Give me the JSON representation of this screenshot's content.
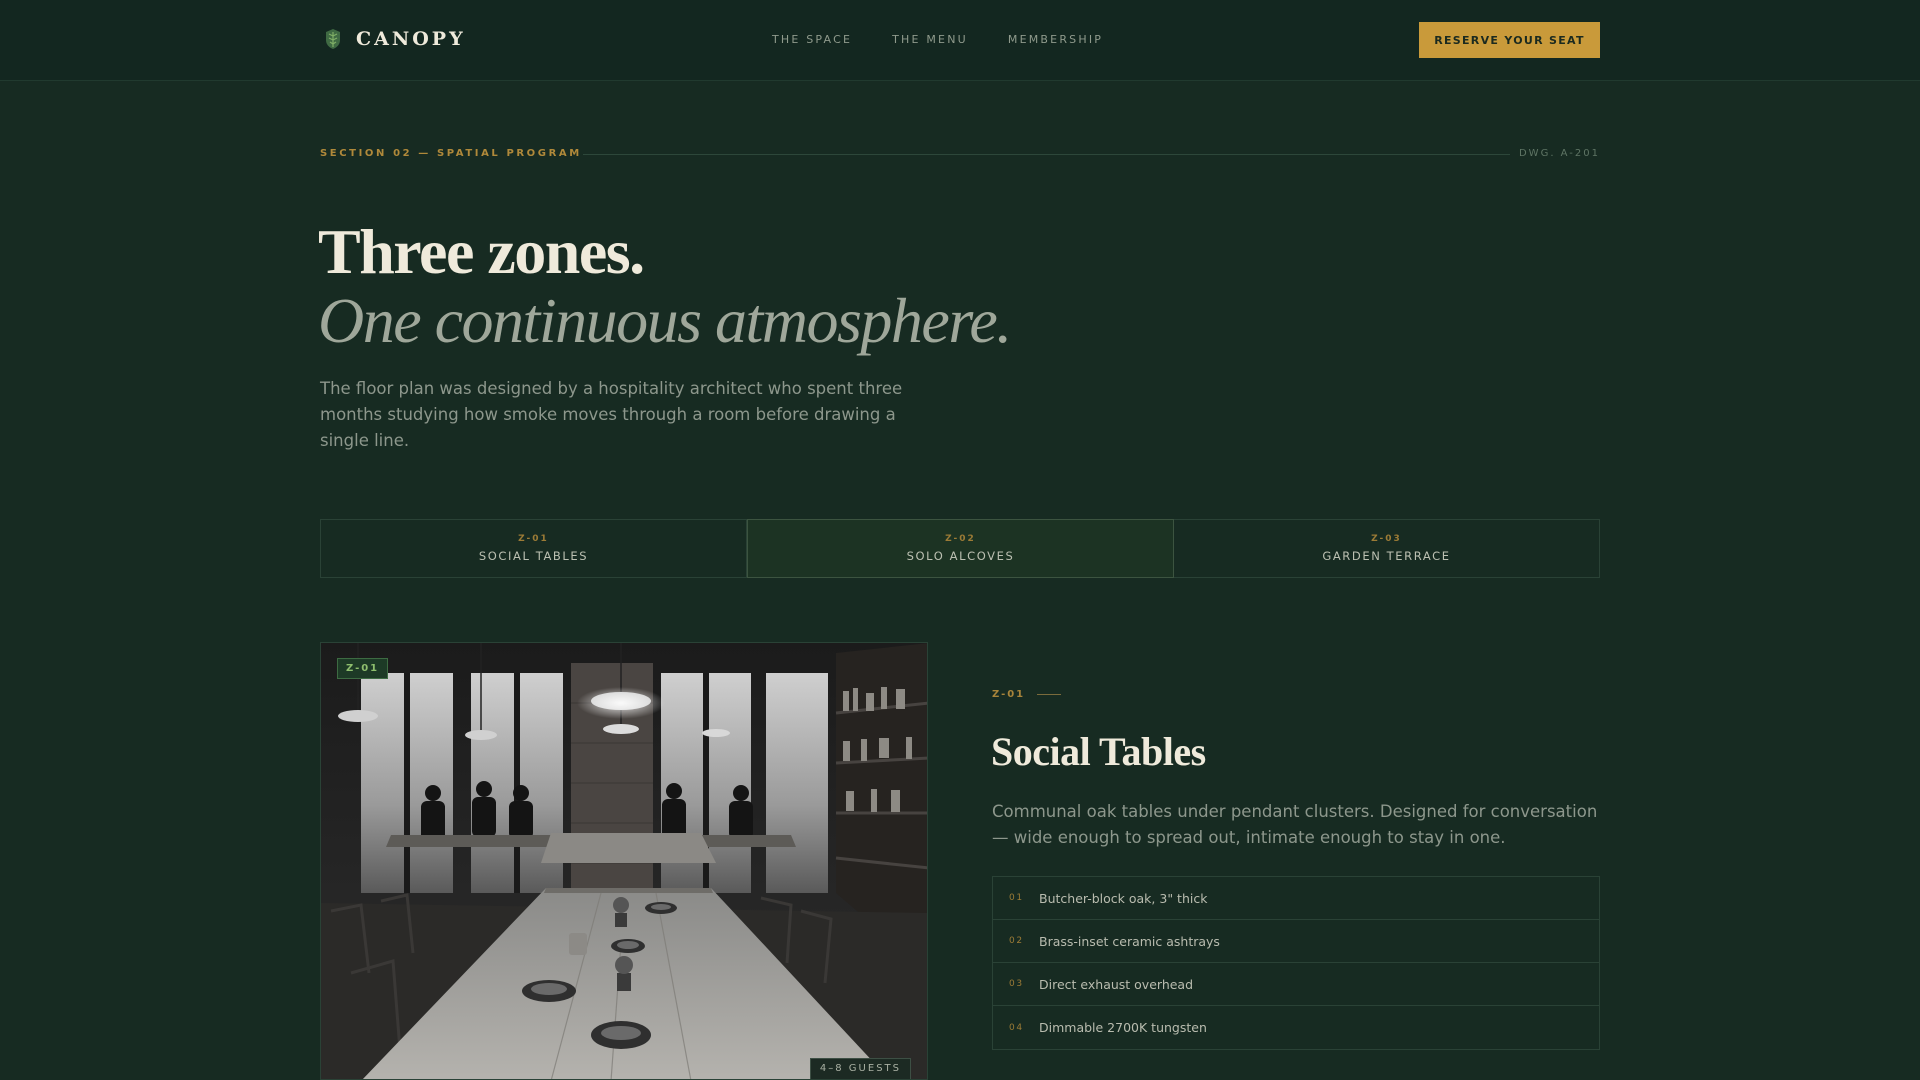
{
  "nav": {
    "brand": "CANOPY",
    "links": [
      "THE SPACE",
      "THE MENU",
      "MEMBERSHIP"
    ],
    "cta": "RESERVE YOUR SEAT"
  },
  "section": {
    "eyebrow": "SECTION 02 — SPATIAL PROGRAM",
    "drawing_ref": "DWG. A-201",
    "title": "Three zones.",
    "subtitle": "One continuous atmosphere.",
    "lede": "The floor plan was designed by a hospitality architect who spent three months studying how smoke moves through a room before drawing a single line."
  },
  "tabs": [
    {
      "code": "Z-01",
      "label": "SOCIAL TABLES",
      "active": false
    },
    {
      "code": "Z-02",
      "label": "SOLO ALCOVES",
      "active": true
    },
    {
      "code": "Z-03",
      "label": "GARDEN TERRACE",
      "active": false
    }
  ],
  "zone": {
    "photo_tag": "Z-01",
    "guests": "4–8 GUESTS",
    "code": "Z-01",
    "title": "Social Tables",
    "description": "Communal oak tables under pendant clusters. Designed for conversation — wide enough to spread out, intimate enough to stay in one.",
    "features": [
      {
        "num": "01",
        "text": "Butcher-block oak, 3\" thick"
      },
      {
        "num": "02",
        "text": "Brass-inset ceramic ashtrays"
      },
      {
        "num": "03",
        "text": "Direct exhaust overhead"
      },
      {
        "num": "04",
        "text": "Dimmable 2700K tungsten"
      }
    ]
  },
  "colors": {
    "background": "#172b22",
    "accent_gold": "#c99a3a",
    "heading": "#efeadb",
    "muted": "#8d978c"
  },
  "icons": {
    "brand": "leaf-crest-icon"
  }
}
